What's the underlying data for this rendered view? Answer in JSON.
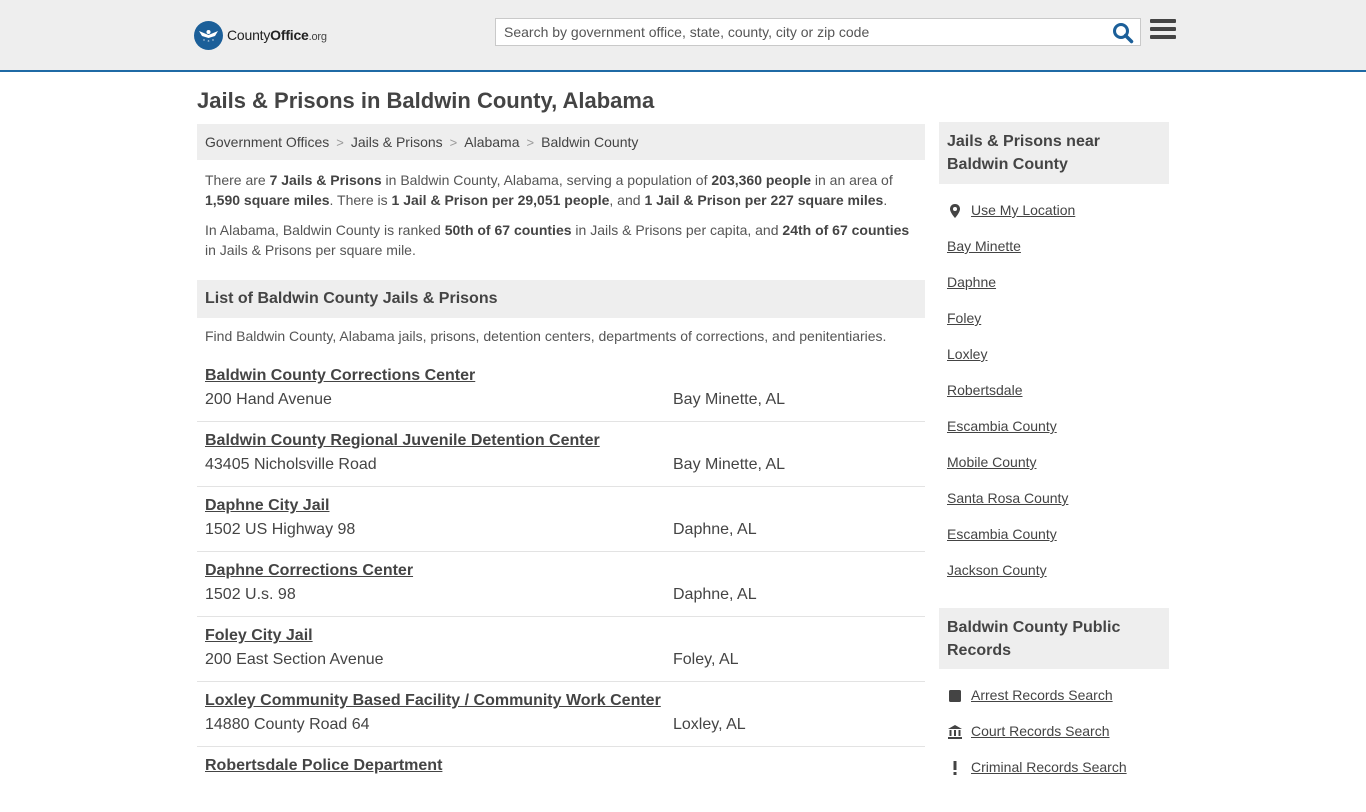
{
  "header": {
    "logo_county": "County",
    "logo_office": "Office",
    "logo_org": ".org",
    "search_placeholder": "Search by government office, state, county, city or zip code"
  },
  "page_title": "Jails & Prisons in Baldwin County, Alabama",
  "breadcrumb": [
    "Government Offices",
    "Jails & Prisons",
    "Alabama",
    "Baldwin County"
  ],
  "intro1": {
    "p1": "There are ",
    "b1": "7 Jails & Prisons",
    "p2": " in Baldwin County, Alabama, serving a population of ",
    "b2": "203,360 people",
    "p3": " in an area of ",
    "b3": "1,590 square miles",
    "p4": ". There is ",
    "b4": "1 Jail & Prison per 29,051 people",
    "p5": ", and ",
    "b5": "1 Jail & Prison per 227 square miles",
    "p6": "."
  },
  "intro2": {
    "p1": "In Alabama, Baldwin County is ranked ",
    "b1": "50th of 67 counties",
    "p2": " in Jails & Prisons per capita, and ",
    "b2": "24th of 67 counties",
    "p3": " in Jails & Prisons per square mile."
  },
  "list_heading": "List of Baldwin County Jails & Prisons",
  "list_description": "Find Baldwin County, Alabama jails, prisons, detention centers, departments of corrections, and penitentiaries.",
  "facilities": [
    {
      "name": "Baldwin County Corrections Center",
      "address": "200 Hand Avenue",
      "city": "Bay Minette, AL"
    },
    {
      "name": "Baldwin County Regional Juvenile Detention Center",
      "address": "43405 Nicholsville Road",
      "city": "Bay Minette, AL"
    },
    {
      "name": "Daphne City Jail",
      "address": "1502 US Highway 98",
      "city": "Daphne, AL"
    },
    {
      "name": "Daphne Corrections Center",
      "address": "1502 U.s. 98",
      "city": "Daphne, AL"
    },
    {
      "name": "Foley City Jail",
      "address": "200 East Section Avenue",
      "city": "Foley, AL"
    },
    {
      "name": "Loxley Community Based Facility / Community Work Center",
      "address": "14880 County Road 64",
      "city": "Loxley, AL"
    },
    {
      "name": "Robertsdale Police Department",
      "address": "",
      "city": ""
    }
  ],
  "sidebar": {
    "near_heading": "Jails & Prisons near Baldwin County",
    "use_location": "Use My Location",
    "near_links": [
      "Bay Minette",
      "Daphne",
      "Foley",
      "Loxley",
      "Robertsdale",
      "Escambia County",
      "Mobile County",
      "Santa Rosa County",
      "Escambia County",
      "Jackson County"
    ],
    "records_heading": "Baldwin County Public Records",
    "records_links": [
      {
        "label": "Arrest Records Search",
        "icon": "square-icon"
      },
      {
        "label": "Court Records Search",
        "icon": "courthouse-icon"
      },
      {
        "label": "Criminal Records Search",
        "icon": "exclamation-icon"
      }
    ]
  },
  "colors": {
    "accent": "#1f6aa5",
    "search_icon": "#1b5f99",
    "panel": "#eeeeee"
  }
}
